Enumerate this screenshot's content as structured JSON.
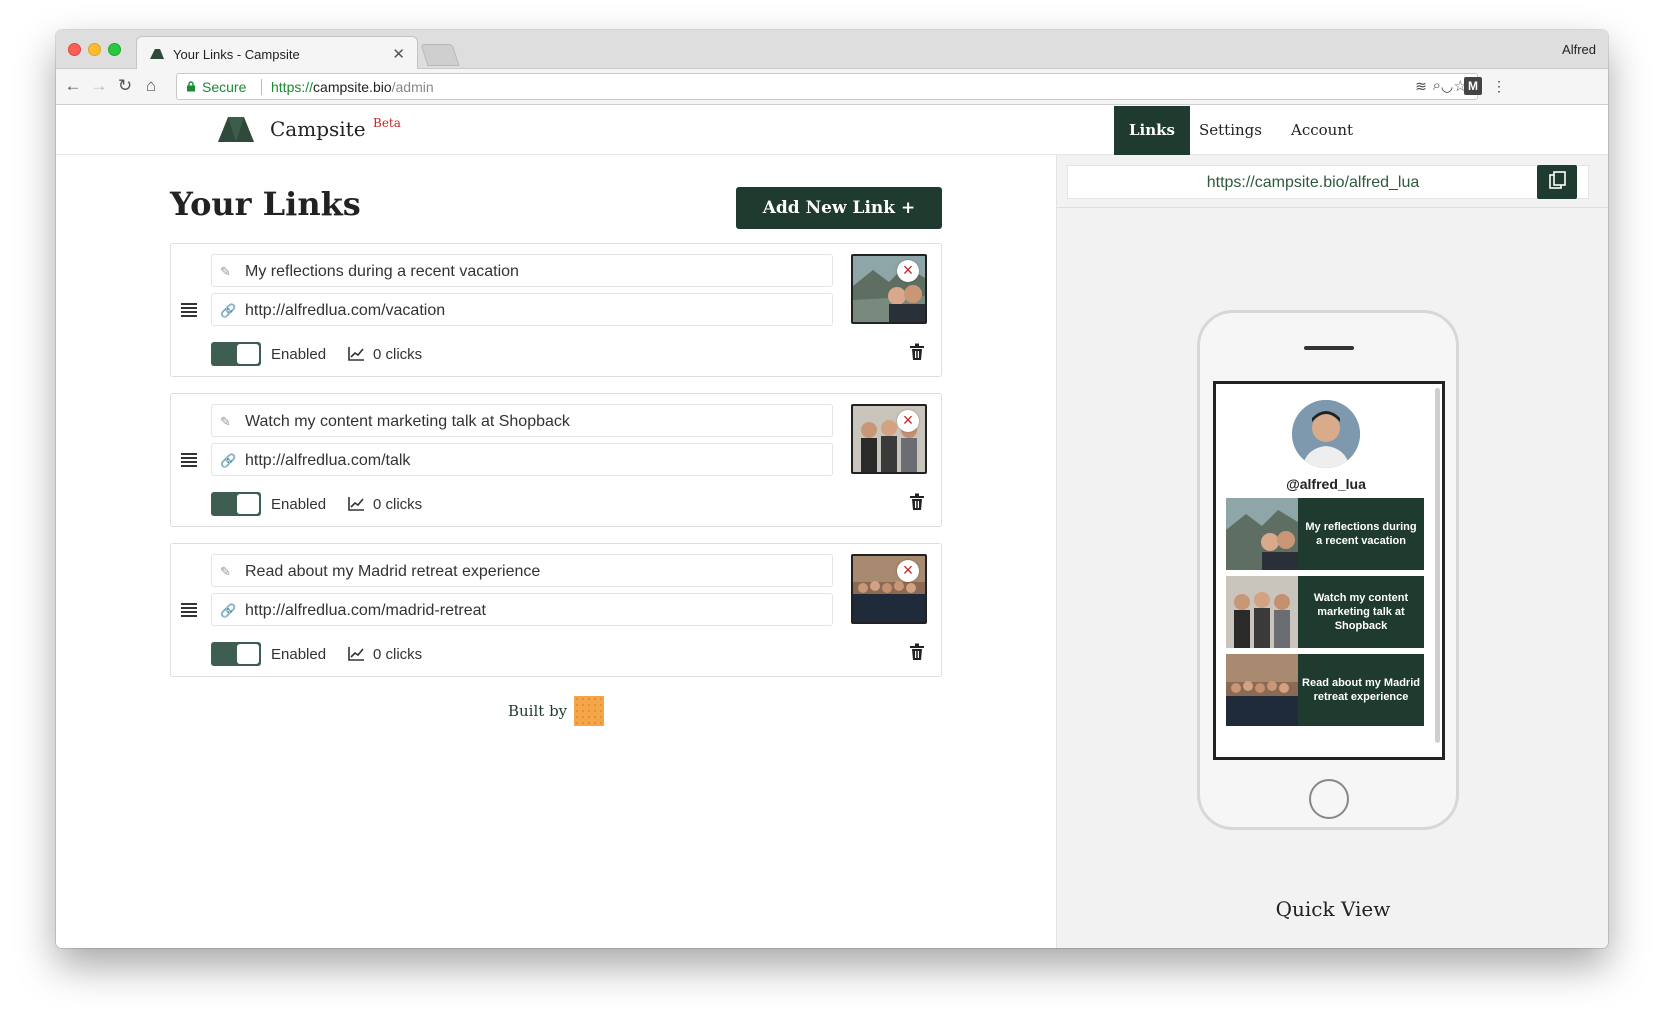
{
  "browser": {
    "tab_title": "Your Links - Campsite",
    "profile_name": "Alfred",
    "secure_label": "Secure",
    "url_scheme": "https://",
    "url_host": "campsite.bio",
    "url_path": "/admin"
  },
  "header": {
    "brand": "Campsite",
    "beta": "Beta",
    "nav": [
      {
        "label": "Links",
        "active": true
      },
      {
        "label": "Settings",
        "active": false
      },
      {
        "label": "Account",
        "active": false
      }
    ]
  },
  "main": {
    "title": "Your Links",
    "add_button": "Add New Link +",
    "links": [
      {
        "title": "My reflections during a recent vacation",
        "url": "http://alfredlua.com/vacation",
        "status": "Enabled",
        "clicks": "0 clicks"
      },
      {
        "title": "Watch my content marketing talk at Shopback",
        "url": "http://alfredlua.com/talk",
        "status": "Enabled",
        "clicks": "0 clicks"
      },
      {
        "title": "Read about my Madrid retreat experience",
        "url": "http://alfredlua.com/madrid-retreat",
        "status": "Enabled",
        "clicks": "0 clicks"
      }
    ],
    "built_by": "Built by"
  },
  "preview": {
    "share_url": "https://campsite.bio/alfred_lua",
    "handle": "@alfred_lua",
    "links": [
      "My reflections during a recent vacation",
      "Watch my content marketing talk at Shopback",
      "Read about my Madrid retreat experience"
    ],
    "quick_view": "Quick View"
  },
  "colors": {
    "brand_green": "#1f3b30",
    "toggle_green": "#3f5e52",
    "secure_green": "#1a8a33",
    "beta_red": "#c62828"
  }
}
